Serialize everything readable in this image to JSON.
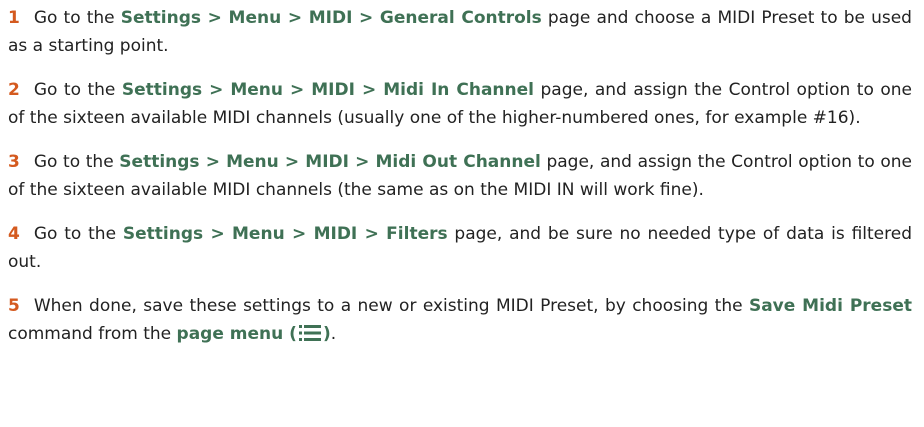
{
  "steps": [
    {
      "number": "1",
      "pre": "Go to the ",
      "path": "Settings > Menu > MIDI > General Controls",
      "post": " page and choose a MIDI Preset to be used as a starting point."
    },
    {
      "number": "2",
      "pre": "Go to the ",
      "path": "Settings > Menu > MIDI > Midi In Channel",
      "post": " page, and assign the Control option to one of the sixteen available MIDI channels (usually one of the higher-numbered ones, for example #16)."
    },
    {
      "number": "3",
      "pre": "Go to the ",
      "path": "Settings > Menu > MIDI > Midi Out Channel",
      "post": " page, and assign the Control option to one of the sixteen available MIDI channels (the same as on the MIDI IN will work fine)."
    },
    {
      "number": "4",
      "pre": "Go to the ",
      "path": "Settings > Menu > MIDI > Filters",
      "post": " page, and be sure no needed type of data is filtered out."
    },
    {
      "number": "5",
      "pre": "When done, save these settings to a new or existing MIDI Preset, by choosing the ",
      "command": "Save Midi Preset",
      "mid": " command from the ",
      "menu_label": "page menu (",
      "menu_close": ")",
      "post": ".",
      "menu_icon": "hamburger-menu-icon"
    }
  ],
  "colors": {
    "number": "#d45a1f",
    "path": "#3f7155",
    "text": "#222222"
  }
}
